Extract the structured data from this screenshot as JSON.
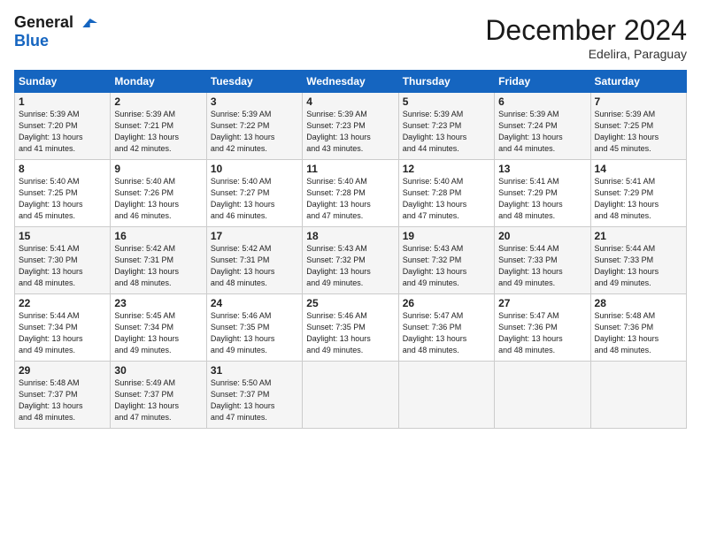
{
  "logo": {
    "line1": "General",
    "line2": "Blue"
  },
  "header": {
    "month": "December 2024",
    "location": "Edelira, Paraguay"
  },
  "weekdays": [
    "Sunday",
    "Monday",
    "Tuesday",
    "Wednesday",
    "Thursday",
    "Friday",
    "Saturday"
  ],
  "weeks": [
    [
      {
        "day": "1",
        "sunrise": "5:39 AM",
        "sunset": "7:20 PM",
        "daylight": "13 hours and 41 minutes."
      },
      {
        "day": "2",
        "sunrise": "5:39 AM",
        "sunset": "7:21 PM",
        "daylight": "13 hours and 42 minutes."
      },
      {
        "day": "3",
        "sunrise": "5:39 AM",
        "sunset": "7:22 PM",
        "daylight": "13 hours and 42 minutes."
      },
      {
        "day": "4",
        "sunrise": "5:39 AM",
        "sunset": "7:23 PM",
        "daylight": "13 hours and 43 minutes."
      },
      {
        "day": "5",
        "sunrise": "5:39 AM",
        "sunset": "7:23 PM",
        "daylight": "13 hours and 44 minutes."
      },
      {
        "day": "6",
        "sunrise": "5:39 AM",
        "sunset": "7:24 PM",
        "daylight": "13 hours and 44 minutes."
      },
      {
        "day": "7",
        "sunrise": "5:39 AM",
        "sunset": "7:25 PM",
        "daylight": "13 hours and 45 minutes."
      }
    ],
    [
      {
        "day": "8",
        "sunrise": "5:40 AM",
        "sunset": "7:25 PM",
        "daylight": "13 hours and 45 minutes."
      },
      {
        "day": "9",
        "sunrise": "5:40 AM",
        "sunset": "7:26 PM",
        "daylight": "13 hours and 46 minutes."
      },
      {
        "day": "10",
        "sunrise": "5:40 AM",
        "sunset": "7:27 PM",
        "daylight": "13 hours and 46 minutes."
      },
      {
        "day": "11",
        "sunrise": "5:40 AM",
        "sunset": "7:28 PM",
        "daylight": "13 hours and 47 minutes."
      },
      {
        "day": "12",
        "sunrise": "5:40 AM",
        "sunset": "7:28 PM",
        "daylight": "13 hours and 47 minutes."
      },
      {
        "day": "13",
        "sunrise": "5:41 AM",
        "sunset": "7:29 PM",
        "daylight": "13 hours and 48 minutes."
      },
      {
        "day": "14",
        "sunrise": "5:41 AM",
        "sunset": "7:29 PM",
        "daylight": "13 hours and 48 minutes."
      }
    ],
    [
      {
        "day": "15",
        "sunrise": "5:41 AM",
        "sunset": "7:30 PM",
        "daylight": "13 hours and 48 minutes."
      },
      {
        "day": "16",
        "sunrise": "5:42 AM",
        "sunset": "7:31 PM",
        "daylight": "13 hours and 48 minutes."
      },
      {
        "day": "17",
        "sunrise": "5:42 AM",
        "sunset": "7:31 PM",
        "daylight": "13 hours and 48 minutes."
      },
      {
        "day": "18",
        "sunrise": "5:43 AM",
        "sunset": "7:32 PM",
        "daylight": "13 hours and 49 minutes."
      },
      {
        "day": "19",
        "sunrise": "5:43 AM",
        "sunset": "7:32 PM",
        "daylight": "13 hours and 49 minutes."
      },
      {
        "day": "20",
        "sunrise": "5:44 AM",
        "sunset": "7:33 PM",
        "daylight": "13 hours and 49 minutes."
      },
      {
        "day": "21",
        "sunrise": "5:44 AM",
        "sunset": "7:33 PM",
        "daylight": "13 hours and 49 minutes."
      }
    ],
    [
      {
        "day": "22",
        "sunrise": "5:44 AM",
        "sunset": "7:34 PM",
        "daylight": "13 hours and 49 minutes."
      },
      {
        "day": "23",
        "sunrise": "5:45 AM",
        "sunset": "7:34 PM",
        "daylight": "13 hours and 49 minutes."
      },
      {
        "day": "24",
        "sunrise": "5:46 AM",
        "sunset": "7:35 PM",
        "daylight": "13 hours and 49 minutes."
      },
      {
        "day": "25",
        "sunrise": "5:46 AM",
        "sunset": "7:35 PM",
        "daylight": "13 hours and 49 minutes."
      },
      {
        "day": "26",
        "sunrise": "5:47 AM",
        "sunset": "7:36 PM",
        "daylight": "13 hours and 48 minutes."
      },
      {
        "day": "27",
        "sunrise": "5:47 AM",
        "sunset": "7:36 PM",
        "daylight": "13 hours and 48 minutes."
      },
      {
        "day": "28",
        "sunrise": "5:48 AM",
        "sunset": "7:36 PM",
        "daylight": "13 hours and 48 minutes."
      }
    ],
    [
      {
        "day": "29",
        "sunrise": "5:48 AM",
        "sunset": "7:37 PM",
        "daylight": "13 hours and 48 minutes."
      },
      {
        "day": "30",
        "sunrise": "5:49 AM",
        "sunset": "7:37 PM",
        "daylight": "13 hours and 47 minutes."
      },
      {
        "day": "31",
        "sunrise": "5:50 AM",
        "sunset": "7:37 PM",
        "daylight": "13 hours and 47 minutes."
      },
      null,
      null,
      null,
      null
    ]
  ]
}
